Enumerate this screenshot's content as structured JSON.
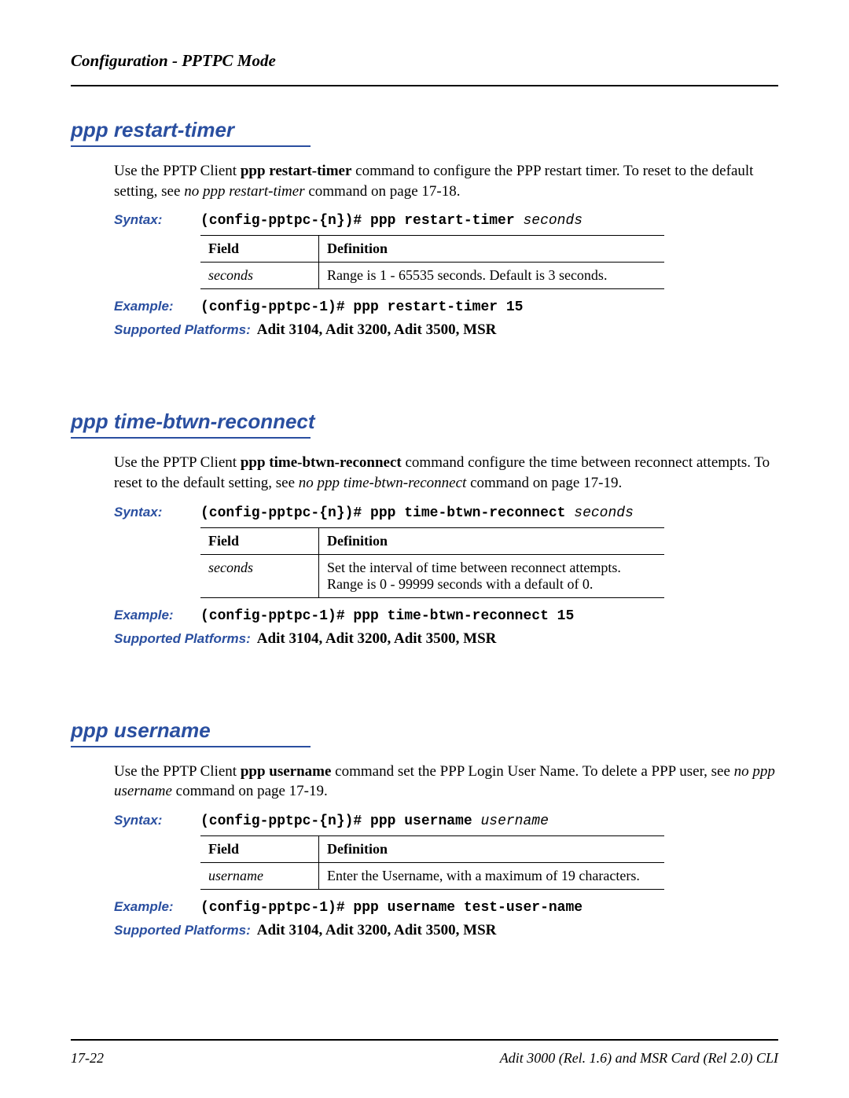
{
  "header": {
    "title": "Configuration - PPTPC Mode"
  },
  "labels": {
    "syntax": "Syntax:",
    "example": "Example:",
    "platforms": "Supported Platforms:",
    "field": "Field",
    "definition": "Definition"
  },
  "sections": [
    {
      "title": "ppp restart-timer",
      "desc_pre": "Use the PPTP Client ",
      "desc_cmd": "ppp restart-timer",
      "desc_mid": " command to configure the PPP restart timer. To reset to the default setting, see ",
      "desc_ref": "no ppp restart-timer",
      "desc_post": " command on page 17-18.",
      "syntax_cmd": "(config-pptpc-{n})# ppp restart-timer ",
      "syntax_arg": "seconds",
      "table": [
        {
          "field": "seconds",
          "def": "Range is 1 - 65535 seconds. Default is 3 seconds."
        }
      ],
      "example": "(config-pptpc-1)# ppp restart-timer 15",
      "platforms": "Adit 3104, Adit 3200, Adit 3500, MSR"
    },
    {
      "title": "ppp time-btwn-reconnect",
      "desc_pre": "Use the PPTP Client ",
      "desc_cmd": "ppp time-btwn-reconnect",
      "desc_mid": " command configure the time between reconnect attempts. To reset to the default setting, see ",
      "desc_ref": "no ppp time-btwn-reconnect",
      "desc_post": " command on page 17-19.",
      "syntax_cmd": "(config-pptpc-{n})# ppp time-btwn-reconnect ",
      "syntax_arg": "seconds",
      "table": [
        {
          "field": "seconds",
          "def": "Set the interval of time between reconnect attempts. Range is 0 - 99999 seconds with a default of 0."
        }
      ],
      "example": "(config-pptpc-1)# ppp time-btwn-reconnect 15",
      "platforms": "Adit 3104, Adit 3200, Adit 3500, MSR"
    },
    {
      "title": "ppp username",
      "desc_pre": "Use the PPTP Client ",
      "desc_cmd": "ppp username",
      "desc_mid": " command set the PPP Login User Name. To delete a PPP user, see ",
      "desc_ref": "no ppp username",
      "desc_post": " command on page 17-19.",
      "syntax_cmd": "(config-pptpc-{n})# ppp username ",
      "syntax_arg": "username",
      "table": [
        {
          "field": "username",
          "def": "Enter the Username, with a maximum of 19 characters."
        }
      ],
      "example": "(config-pptpc-1)# ppp username test-user-name",
      "platforms": "Adit 3104, Adit 3200, Adit 3500, MSR"
    }
  ],
  "footer": {
    "page": "17-22",
    "book": "Adit 3000 (Rel. 1.6) and MSR Card (Rel 2.0) CLI"
  }
}
